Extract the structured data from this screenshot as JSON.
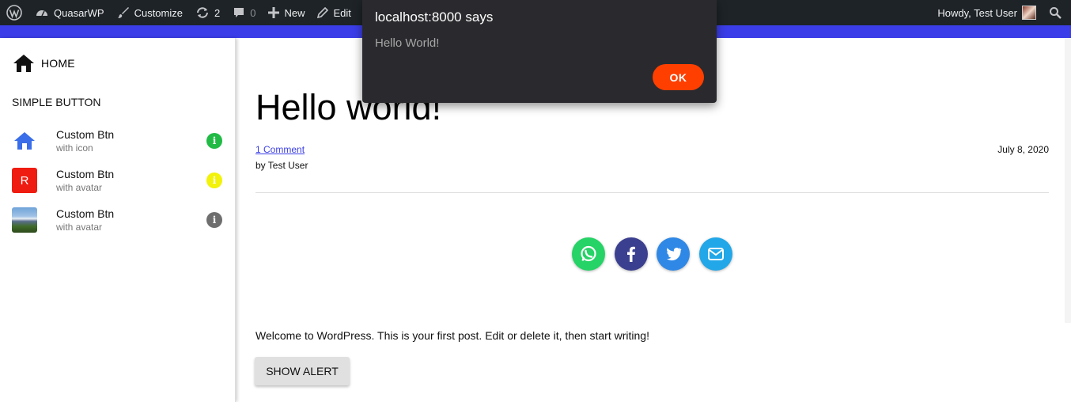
{
  "adminbar": {
    "site_name": "QuasarWP",
    "customize": "Customize",
    "updates_count": "2",
    "comments_count": "0",
    "new_label": "New",
    "edit_label": "Edit",
    "howdy": "Howdy, Test User"
  },
  "drawer": {
    "home_label": "HOME",
    "section_title": "SIMPLE BUTTON",
    "items": [
      {
        "title": "Custom Btn",
        "subtitle": "with icon",
        "info_color": "#21ba45"
      },
      {
        "title": "Custom Btn",
        "subtitle": "with avatar",
        "avatar_letter": "R",
        "info_color": "#f2f20a"
      },
      {
        "title": "Custom Btn",
        "subtitle": "with avatar",
        "info_color": "#6e6e6e"
      }
    ]
  },
  "post": {
    "title": "Hello world!",
    "comments_link": "1 Comment",
    "byline": "by Test User",
    "date": "July 8, 2020",
    "body": "Welcome to WordPress. This is your first post. Edit or delete it, then start writing!",
    "button_label": "SHOW ALERT",
    "share": [
      {
        "icon": "whatsapp-icon",
        "color": "#25d366"
      },
      {
        "icon": "facebook-icon",
        "color": "#3b3f8f"
      },
      {
        "icon": "twitter-icon",
        "color": "#2f88e6"
      },
      {
        "icon": "email-icon",
        "color": "#22a7e8"
      }
    ]
  },
  "dialog": {
    "title": "localhost:8000 says",
    "message": "Hello World!",
    "ok_label": "OK"
  },
  "colors": {
    "accent": "#3b3ee8",
    "adminbar_bg": "#1d2327",
    "ok_button": "#ff3f00"
  }
}
